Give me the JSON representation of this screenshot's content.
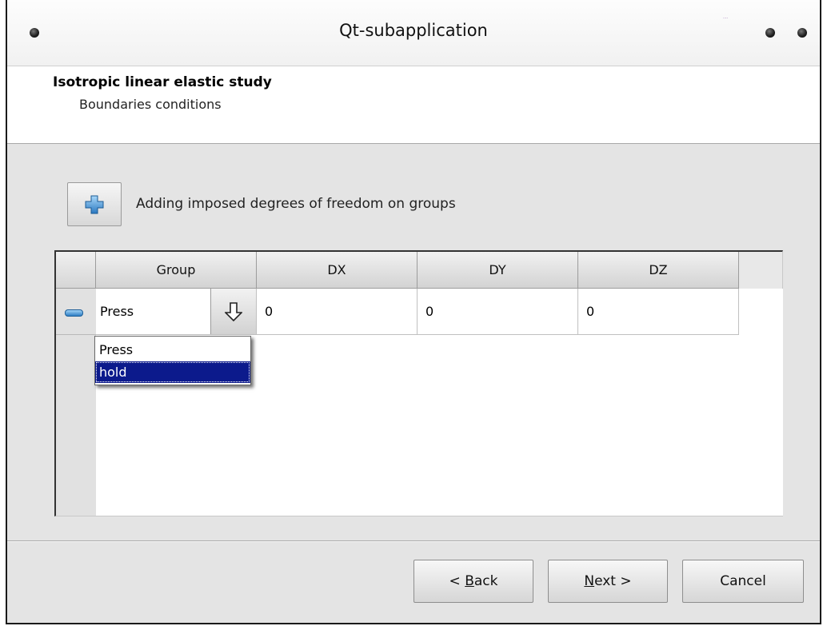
{
  "window": {
    "title": "Qt-subapplication",
    "corner_text": "····"
  },
  "header": {
    "title": "Isotropic linear elastic study",
    "subtitle": "Boundaries conditions"
  },
  "toolbar": {
    "add_icon": "plus-icon",
    "add_label": "Adding imposed degrees of freedom on groups"
  },
  "table": {
    "columns": [
      "Group",
      "DX",
      "DY",
      "DZ"
    ],
    "rows": [
      {
        "remove_icon": "minus-icon",
        "group": "Press",
        "dx": "0",
        "dy": "0",
        "dz": "0"
      }
    ]
  },
  "dropdown": {
    "options": [
      "Press",
      "hold"
    ],
    "highlighted": "hold"
  },
  "buttons": {
    "back": {
      "prefix": "< ",
      "mnemonic": "B",
      "rest": "ack"
    },
    "next": {
      "prefix": "",
      "mnemonic": "N",
      "rest": "ext >"
    },
    "cancel": "Cancel"
  },
  "colors": {
    "selection": "#0c1a8c",
    "icon_blue": "#2f7fc4"
  }
}
